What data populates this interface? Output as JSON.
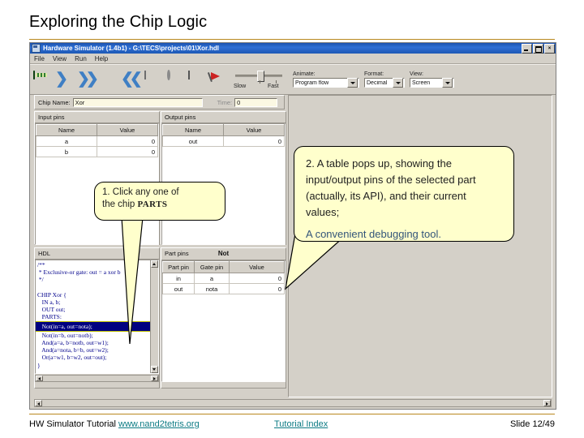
{
  "slide": {
    "title": "Exploring the Chip Logic",
    "accent_color": "#b9881f"
  },
  "app": {
    "window_title": "Hardware Simulator (1.4b1) - G:\\TECS\\projects\\01\\Xor.hdl",
    "window_buttons": [
      "minimize",
      "maximize",
      "close"
    ],
    "menu": [
      "File",
      "View",
      "Run",
      "Help"
    ],
    "toolbar": {
      "icons": [
        "load-chip-icon",
        "single-step-icon",
        "run-icon",
        "stop-icon",
        "rewind-icon",
        "load-script-icon",
        "clock-icon",
        "script-icon",
        "breakpoints-icon"
      ],
      "speed": {
        "slow_label": "Slow",
        "fast_label": "Fast"
      },
      "animate": {
        "label": "Animate:",
        "value": "Program flow"
      },
      "format": {
        "label": "Format:",
        "value": "Decimal"
      },
      "view": {
        "label": "View:",
        "value": "Screen"
      }
    },
    "chip_row": {
      "chip_name_label": "Chip Name:",
      "chip_name_value": "Xor",
      "time_label": "Time:",
      "time_value": "0"
    },
    "input_pins": {
      "title": "Input pins",
      "columns": [
        "Name",
        "Value"
      ],
      "rows": [
        {
          "name": "a",
          "value": "0"
        },
        {
          "name": "b",
          "value": "0"
        }
      ]
    },
    "output_pins": {
      "title": "Output pins",
      "columns": [
        "Name",
        "Value"
      ],
      "rows": [
        {
          "name": "out",
          "value": "0"
        }
      ]
    },
    "hdl": {
      "title": "HDL",
      "code_before": "/**\n * Exclusive-or gate: out = a xor b\n */\n\nCHIP Xor {\n   IN a, b;\n   OUT out;\n   PARTS:",
      "selected_line": "   Not(in=a, out=nota);",
      "code_after": "   Not(in=b, out=notb);\n   And(a=a, b=notb, out=w1);\n   And(a=nota, b=b, out=w2);\n   Or(a=w1, b=w2, out=out);\n}"
    },
    "part_pins": {
      "title": "Part pins",
      "part_name": "Not",
      "columns": [
        "Part pin",
        "Gate pin",
        "Value"
      ],
      "rows": [
        {
          "part_pin": "in",
          "gate_pin": "a",
          "value": "0"
        },
        {
          "part_pin": "out",
          "gate_pin": "nota",
          "value": "0"
        }
      ]
    }
  },
  "callouts": {
    "one": {
      "line1": "1. Click any one of",
      "line2_prefix": "the chip ",
      "line2_bold": "PARTS"
    },
    "two": {
      "body": "2. A table pops up, showing the input/output pins of the selected part (actually, its API), and their current values;",
      "note": "A convenient debugging tool."
    }
  },
  "footer": {
    "left_text": "HW Simulator Tutorial ",
    "left_link": "www.nand2tetris.org",
    "middle_link": "Tutorial Index",
    "right_text": "Slide 12/49"
  }
}
